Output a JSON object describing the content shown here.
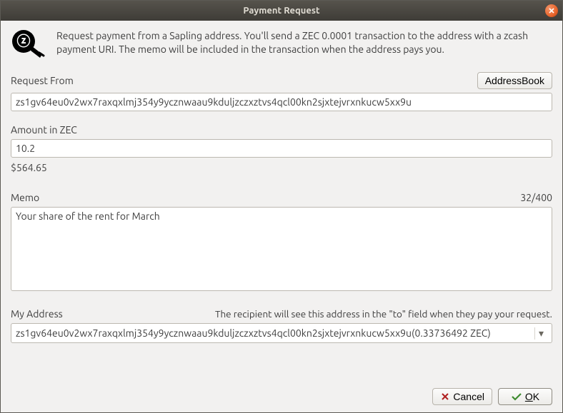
{
  "title": "Payment Request",
  "intro": "Request payment from a Sapling address. You'll send a ZEC 0.0001 transaction to the address with a zcash payment URI. The memo will be included in the transaction when the address pays you.",
  "request_from": {
    "label": "Request From",
    "address_book_btn": "AddressBook",
    "value": "zs1gv64eu0v2wx7raxqxlmj354y9ycznwaau9kduljzczxztvs4qcl00kn2sjxtejvrxnkucw5xx9u"
  },
  "amount": {
    "label": "Amount in ZEC",
    "value": "10.2",
    "usd": "$564.65"
  },
  "memo": {
    "label": "Memo",
    "counter": "32/400",
    "value": "Your share of the rent for March"
  },
  "my_addr": {
    "label": "My Address",
    "hint": "The recipient will see this address in the \"to\" field when they pay your request.",
    "selected": "zs1gv64eu0v2wx7raxqxlmj354y9ycznwaau9kduljzczxztvs4qcl00kn2sjxtejvrxnkucw5xx9u(0.33736492 ZEC)"
  },
  "buttons": {
    "cancel": "Cancel",
    "ok": "OK"
  }
}
